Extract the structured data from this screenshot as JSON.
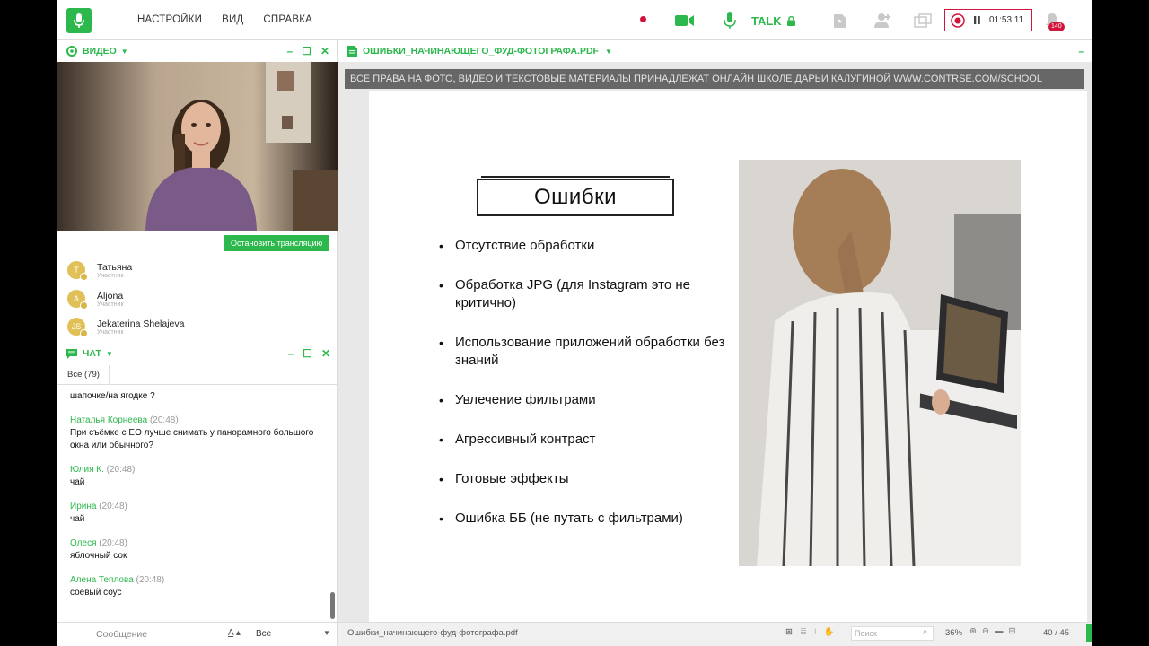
{
  "menu": [
    "НАСТРОЙКИ",
    "ВИД",
    "СПРАВКА"
  ],
  "toolbar": {
    "talk_label": "TALK",
    "timer": "01:53:11",
    "notifications_count": "140"
  },
  "video_panel": {
    "title": "ВИДЕО",
    "stop_button": "Остановить трансляцию"
  },
  "users": [
    {
      "initial": "Т",
      "name": "Татьяна",
      "role": "Участник"
    },
    {
      "initial": "A",
      "name": "Aljona",
      "role": "Участник"
    },
    {
      "initial": "JS",
      "name": "Jekaterina Shelajeva",
      "role": "Участник"
    }
  ],
  "chat": {
    "title": "ЧАТ",
    "tab": "Все (79)",
    "messages": [
      {
        "author": "",
        "time": "",
        "text": "шапочке/на ягодке ?"
      },
      {
        "author": "Наталья Корнеева",
        "time": "(20:48)",
        "text": "При съёмке с ЕО лучше снимать у панорамного большого окна или обычного?"
      },
      {
        "author": "Юлия К.",
        "time": "(20:48)",
        "text": "чай"
      },
      {
        "author": "Ирина",
        "time": "(20:48)",
        "text": "чай"
      },
      {
        "author": "Олеся",
        "time": "(20:48)",
        "text": "яблочный сок"
      },
      {
        "author": "Алена Теплова",
        "time": "(20:48)",
        "text": "соевый соус"
      }
    ],
    "input_placeholder": "Сообщение",
    "audience": "Все"
  },
  "document": {
    "title": "ОШИБКИ_НАЧИНАЮЩЕГО_ФУД-ФОТОГРАФА.PDF",
    "watermark": "ВСЕ ПРАВА НА ФОТО, ВИДЕО И ТЕКСТОВЫЕ МАТЕРИАЛЫ ПРИНАДЛЕЖАТ ОНЛАЙН ШКОЛЕ ДАРЬИ КАЛУГИНОЙ WWW.CONTRSE.COM/SCHOOL",
    "slide_title": "Ошибки",
    "bullets": [
      "Отсутствие обработки",
      "Обработка JPG (для Instagram это не критично)",
      "Использование приложений обработки без знаний",
      "Увлечение фильтрами",
      "Агрессивный контраст",
      "Готовые эффекты",
      "Ошибка ББ (не путать с фильтрами)"
    ],
    "filename": "Ошибки_начинающего-фуд-фотографа.pdf",
    "search_placeholder": "Поиск",
    "zoom": "36%",
    "page_current": "40",
    "page_total": "/ 45"
  },
  "colors": {
    "accent": "#2db84d",
    "record": "#d1143c"
  }
}
